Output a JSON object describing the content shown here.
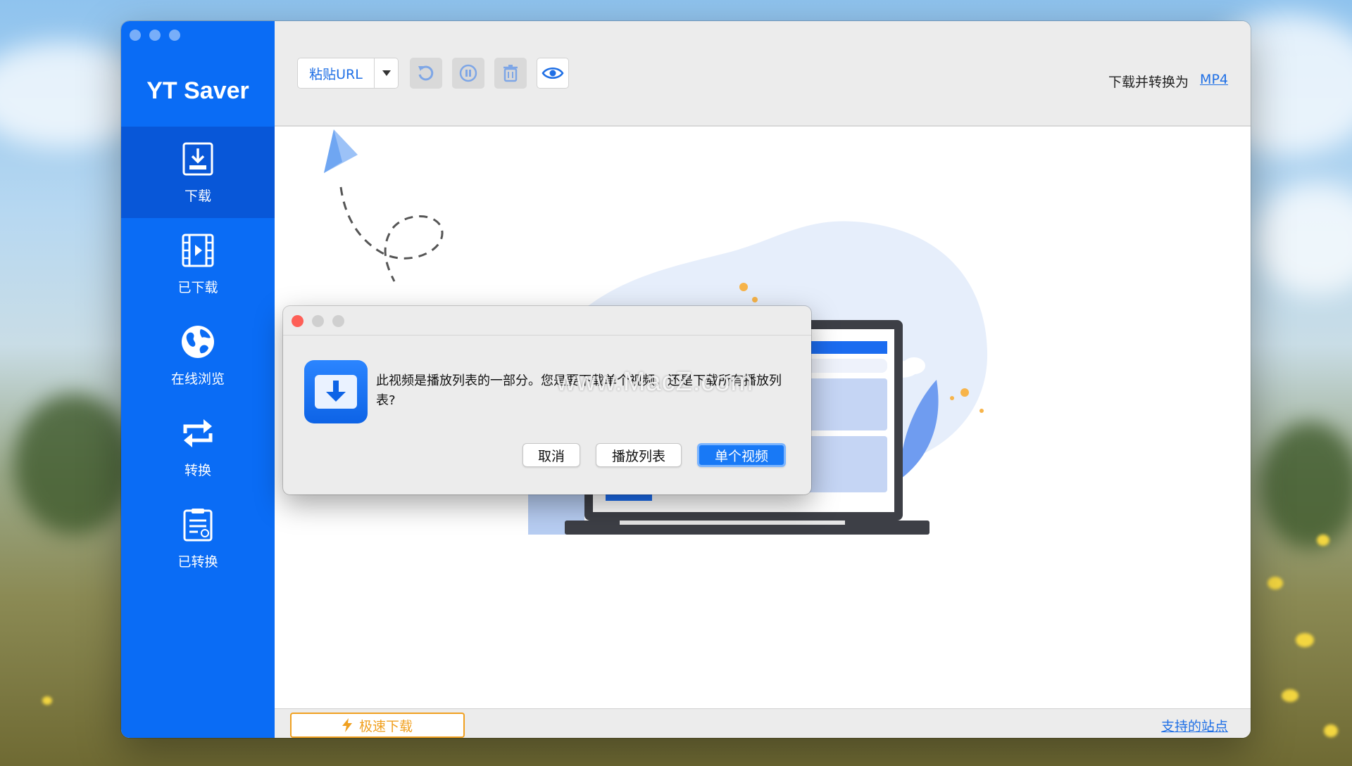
{
  "sidebar": {
    "app_title": "YT Saver",
    "items": [
      {
        "label": "下载",
        "icon": "download-icon"
      },
      {
        "label": "已下载",
        "icon": "film-icon"
      },
      {
        "label": "在线浏览",
        "icon": "globe-icon"
      },
      {
        "label": "转换",
        "icon": "convert-icon"
      },
      {
        "label": "已转换",
        "icon": "converted-list-icon"
      }
    ]
  },
  "toolbar": {
    "paste_url": "粘贴URL",
    "convert_label": "下载并转换为",
    "convert_format": "MP4",
    "icons": [
      "chevron-down-icon",
      "refresh-icon",
      "pause-icon",
      "trash-icon",
      "eye-icon"
    ]
  },
  "statusbar": {
    "turbo_label": "极速下载",
    "sites_link": "支持的站点"
  },
  "dialog": {
    "message": "此视频是播放列表的一部分。您是要下载单个视频，还是下载所有播放列表?",
    "cancel": "取消",
    "playlist": "播放列表",
    "single": "单个视频"
  },
  "watermark": "www.MacZ.com",
  "colors": {
    "sidebar": "#0a6cf5",
    "sidebar_active": "#0857d8",
    "accent": "#1f6fe5",
    "turbo": "#f0a020"
  }
}
